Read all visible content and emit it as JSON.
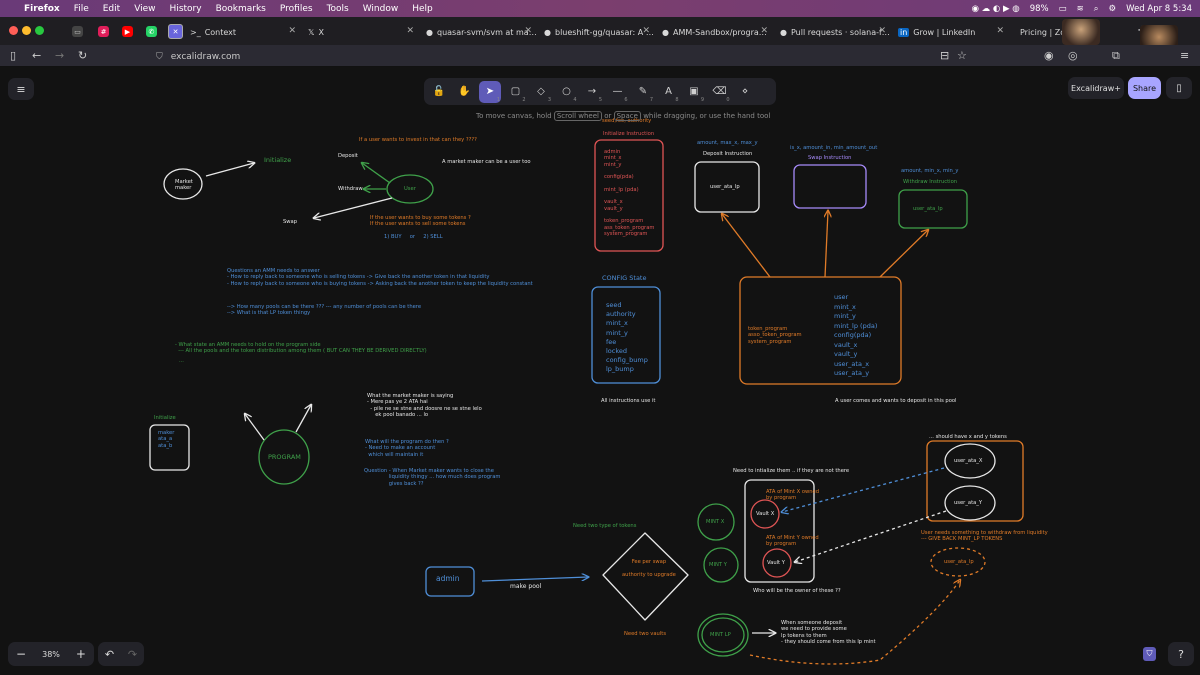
{
  "menubar": {
    "items": [
      "Firefox",
      "File",
      "Edit",
      "View",
      "History",
      "Bookmarks",
      "Profiles",
      "Tools",
      "Window",
      "Help"
    ],
    "battery": "98%",
    "datetime": "Wed Apr 8  5:34"
  },
  "tabs": [
    {
      "label": "Context",
      "icon": "terminal-icon"
    },
    {
      "label": "X",
      "icon": "x-icon"
    },
    {
      "label": "quasar-svm/svm at master",
      "icon": "github-icon"
    },
    {
      "label": "blueshift-gg/quasar: A blaz",
      "icon": "github-icon"
    },
    {
      "label": "AMM-Sandbox/programs/a",
      "icon": "github-icon"
    },
    {
      "label": "Pull requests · solana-foun",
      "icon": "github-icon"
    },
    {
      "label": "Grow | LinkedIn",
      "icon": "linkedin-icon"
    },
    {
      "label": "Pricing | Zorvyn",
      "icon": "page-icon"
    }
  ],
  "url": "excalidraw.com",
  "toolbar": {
    "tools": [
      {
        "name": "lock",
        "glyph": "🔓",
        "num": ""
      },
      {
        "name": "hand",
        "glyph": "✋",
        "num": ""
      },
      {
        "name": "selection",
        "glyph": "➤",
        "num": "1"
      },
      {
        "name": "rectangle",
        "glyph": "▢",
        "num": "2"
      },
      {
        "name": "diamond",
        "glyph": "◇",
        "num": "3"
      },
      {
        "name": "ellipse",
        "glyph": "○",
        "num": "4"
      },
      {
        "name": "arrow",
        "glyph": "→",
        "num": "5"
      },
      {
        "name": "line",
        "glyph": "—",
        "num": "6"
      },
      {
        "name": "draw",
        "glyph": "✎",
        "num": "7"
      },
      {
        "name": "text",
        "glyph": "A",
        "num": "8"
      },
      {
        "name": "image",
        "glyph": "▣",
        "num": "9"
      },
      {
        "name": "eraser",
        "glyph": "⌫",
        "num": "0"
      },
      {
        "name": "more-tools",
        "glyph": "⋄",
        "num": ""
      }
    ],
    "hint_pre": "To move canvas, hold",
    "hint_k1": "Scroll wheel",
    "hint_mid": "or",
    "hint_k2": "Space",
    "hint_post": "while dragging, or use the hand tool"
  },
  "buttons": {
    "excalidraw_plus": "Excalidraw+",
    "share": "Share"
  },
  "zoom": {
    "minus": "−",
    "value": "38%",
    "plus": "+",
    "undo": "↶",
    "redo": "↷"
  },
  "drawing": {
    "market_maker": "Market\nmaker",
    "initialize_top": "Initialize",
    "deposit": "Deposit",
    "withdraw": "Withdraw",
    "swap": "Swap",
    "user": "User",
    "q_invest": "If a user wants to invest in that can they ????",
    "mm_user_too": "A market maker can be a user too",
    "buy_sell": "If the user wants to buy some tokens ?\nIf the user wants to sell some tokens",
    "buy": "1) BUY     or     2) SELL",
    "questions": "Questions an AMM needs to answer\n- How to reply back to someone who is selling tokens -> Give back the another token in that liquidity\n- How to reply back to someone who is buying tokens -> Asking back the another token to keep the liquidity constant",
    "pools": "--> How many pools can be there ??? --- any number of pools can be there\n--> What is that LP token thingy",
    "state": "- What state an AMM needs to hold on the program side\n  --- All the pools and the token distribution among them ( BUT CAN THEY BE DERIVED DIRECTLY)",
    "dots": "...",
    "init_small_title": "Initialize",
    "init_small_box": "maker\nata_a\nata_b",
    "program": "PROGRAM",
    "mm_saying": "What the market maker is saying\n- Mere pas ye 2 ATA hai\n  - pile ne se stne and doosre ne se stne lelo\n     ek pool banado ... lo",
    "program_do": "What will the program do then ?\n- Need to make an account\n  which will maintain it",
    "question_close": "Question - When Market maker wants to close the\n               liquidity thingy ... how much does program\n               gives back ??",
    "init_instr_auth": "seed,fee, authority",
    "init_instr_title": "Initialize Instruction",
    "init_instr_body": "admin\nmint_x\nmint_y\n\nconfig(pda)\n\nmint_lp (pda)\n\nvault_x\nvault_y\n\ntoken_program\nass_token_program\nsystem_program",
    "config_title": "CONFIG State",
    "config_body": "seed\nauthority\nmint_x\nmint_y\nfee\nlocked\nconfig_bump\nlp_bump",
    "all_instr": "All instructions use it",
    "deposit_params": "amount, max_x, max_y",
    "deposit_title": "Deposit Instruction",
    "deposit_box": "user_ata_lp",
    "swap_params": "is_x, amount_in, min_amount_out",
    "swap_title": "Swap Instruction",
    "withdraw_params": "amount, min_x, min_y",
    "withdraw_title": "Withdraw Instruction",
    "withdraw_box": "user_ata_lp",
    "big_left": "token_program\nasso_token_program\nsystem_program",
    "big_right": "user\nmint_x\nmint_y\nmint_lp (pda)\nconfig(pda)\nvault_x\nvault_y\nuser_ata_x\nuser_ata_y",
    "user_deposit": "A user comes and wants to deposit in this pool",
    "should_have": "... should have x and y tokens",
    "user_ata_x": "user_ata_X",
    "user_ata_y": "user_ata_Y",
    "need_init": "Need to intialize them .. if they are not there",
    "ata_x": "ATA of Mint X owned\nby program",
    "vault_x": "Vault X",
    "ata_y": "ATA of Mint Y owned\nby program",
    "vault_y": "Vault Y",
    "owner_q": "Who will be the owner of these ??",
    "mint_x": "MINT X",
    "mint_y": "MINT Y",
    "withdraw_note": "User needs something to withdraw from liquidity\n--- GIVE BACK MINT_LP TOKENS",
    "user_ata_lp": "user_ata_lp",
    "need_two_types": "Need two type of tokens",
    "diamond_text": "Fee per swap\n\nauthority to upgrade",
    "admin": "admin",
    "make_pool": "make pool",
    "need_two_vaults": "Need two vaults",
    "mint_lp": "MINT LP",
    "lp_note": "When someone deposit\nwe need to provide some\nlp tokens to them\n- they should come from this lp mint"
  }
}
